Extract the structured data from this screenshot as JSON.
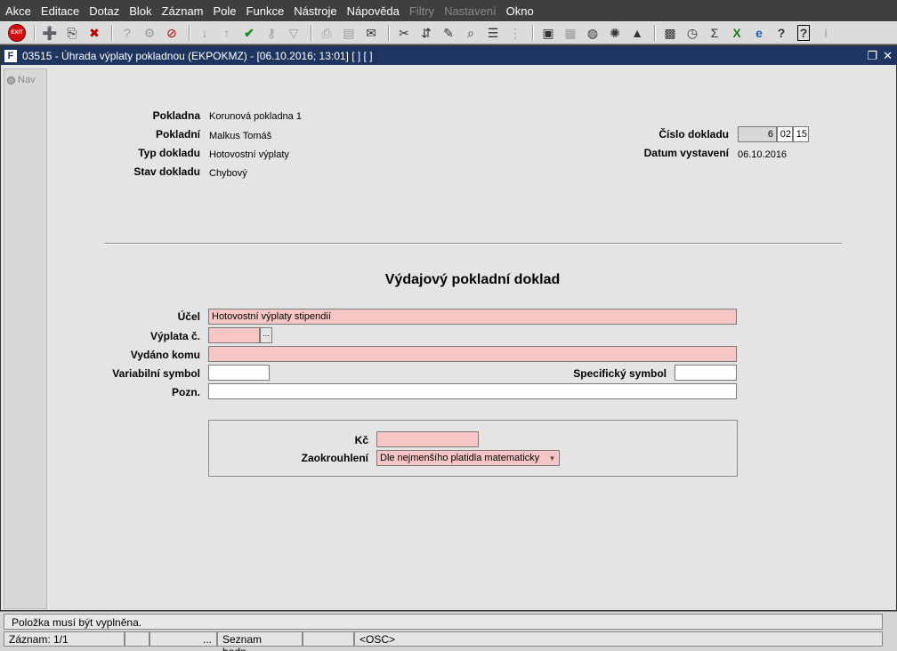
{
  "menu": [
    "Akce",
    "Editace",
    "Dotaz",
    "Blok",
    "Záznam",
    "Pole",
    "Funkce",
    "Nástroje",
    "Nápověda",
    "Filtry",
    "Nastavení",
    "Okno"
  ],
  "menu_disabled": [
    "Filtry",
    "Nastavení"
  ],
  "toolbar": {
    "exit_label": "EXIT",
    "icons": [
      "add-record-icon",
      "copy-record-icon",
      "delete-record-icon",
      "query-icon",
      "query-execute-icon",
      "query-cancel-icon",
      "sort-asc-icon",
      "sort-desc-icon",
      "save-check-icon",
      "key-icon",
      "filter-icon",
      "print-icon",
      "print-setup-icon",
      "mail-icon",
      "cut-icon",
      "paste-icon",
      "edit-icon",
      "find-icon",
      "list-icon",
      "tree-icon",
      "doc-icon",
      "calc-icon",
      "globe-icon",
      "tools-icon",
      "chart-icon",
      "report-icon",
      "clock-icon",
      "sum-icon",
      "excel-icon",
      "ie-icon",
      "help-icon",
      "whats-this-icon",
      "info-icon"
    ]
  },
  "window": {
    "title": "03515 - Úhrada výplaty pokladnou (EKPOKMZ) - [06.10.2016; 13:01]  [ ]  [ ]",
    "nav_tab": "Nav"
  },
  "header": {
    "pokladna_label": "Pokladna",
    "pokladna_value": "Korunová pokladna 1",
    "pokladni_label": "Pokladní",
    "pokladni_value": "Malkus Tomáš",
    "typ_label": "Typ dokladu",
    "typ_value": "Hotovostní výplaty",
    "stav_label": "Stav dokladu",
    "stav_value": "Chybový",
    "cislo_label": "Číslo dokladu",
    "cislo_1": "6",
    "cislo_2": "02",
    "cislo_3": "15",
    "datum_label": "Datum vystavení",
    "datum_value": "06.10.2016"
  },
  "form": {
    "title": "Výdajový pokladní doklad",
    "ucel_label": "Účel",
    "ucel_value": "Hotovostní výplaty stipendií",
    "vyplata_label": "Výplata č.",
    "vyplata_value": "",
    "lov_label": "...",
    "vydano_label": "Vydáno komu",
    "vydano_value": "",
    "vs_label": "Variabilní symbol",
    "vs_value": "",
    "ss_label": "Specifický symbol",
    "ss_value": "",
    "pozn_label": "Pozn.",
    "pozn_value": "",
    "kc_label": "Kč",
    "kc_value": "",
    "zaokrouhleni_label": "Zaokrouhlení",
    "zaokrouhleni_value": "Dle nejmenšího platidla matematicky"
  },
  "status": {
    "message": "Položka musí být vyplněna.",
    "record": "Záznam: 1/1",
    "dots": "...",
    "lov": "Seznam hodn...",
    "mode": "<OSC>"
  }
}
